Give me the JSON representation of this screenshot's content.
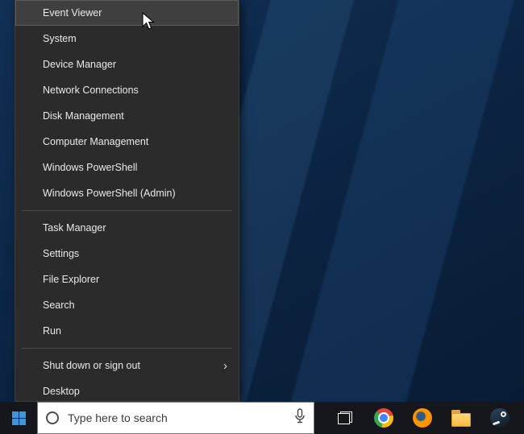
{
  "menu": {
    "submenu_arrow": "›",
    "highlighted_item": "Event Viewer",
    "items": [
      {
        "label": "Event Viewer"
      },
      {
        "label": "System"
      },
      {
        "label": "Device Manager"
      },
      {
        "label": "Network Connections"
      },
      {
        "label": "Disk Management"
      },
      {
        "label": "Computer Management"
      },
      {
        "label": "Windows PowerShell"
      },
      {
        "label": "Windows PowerShell (Admin)"
      },
      {
        "label": "Task Manager"
      },
      {
        "label": "Settings"
      },
      {
        "label": "File Explorer"
      },
      {
        "label": "Search"
      },
      {
        "label": "Run"
      },
      {
        "label": "Shut down or sign out"
      },
      {
        "label": "Desktop"
      }
    ],
    "colors": {
      "background": "#2b2b2b",
      "highlight": "#3f3f3f",
      "text": "#e9e9e9",
      "separator": "#4a4a4a"
    }
  },
  "taskbar": {
    "search": {
      "placeholder": "Type here to search"
    },
    "icons": [
      "start-icon",
      "cortana-circle-icon",
      "microphone-icon",
      "task-view-icon",
      "chrome-icon",
      "firefox-icon",
      "file-explorer-icon",
      "steam-icon"
    ],
    "colors": {
      "background": "#15171c",
      "start_blue": "#3a96dd",
      "search_background": "#ffffff",
      "search_text": "#3c3c3c"
    }
  },
  "desktop": {
    "colors": {
      "base": "#0c2340"
    }
  }
}
